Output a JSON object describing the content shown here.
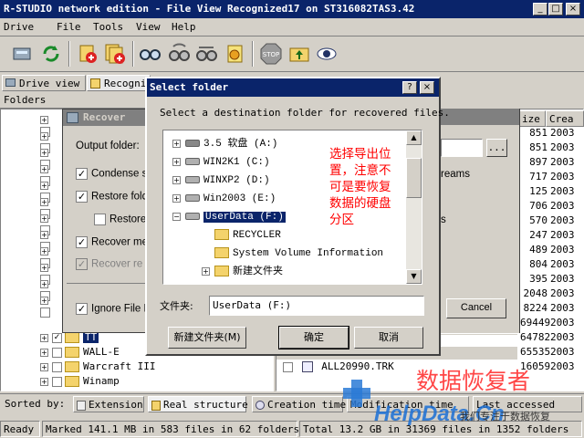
{
  "window": {
    "title": "R-STUDIO network edition - File View Recognized17 on ST316082TAS3.42"
  },
  "menu": [
    "Drive",
    "File",
    "Tools",
    "View",
    "Help"
  ],
  "toolbar": {
    "icons": [
      "drives-icon",
      "refresh-icon",
      "add-icon",
      "add-all-icon",
      "scan-icon",
      "scan-all-icon",
      "recover-icon",
      "open-icon",
      "stop-icon",
      "up-folder-icon",
      "view-icon"
    ],
    "stop_label": "STOP"
  },
  "tabs": {
    "drive_view": "Drive view",
    "recognized": "Recogni"
  },
  "folders_header": "Folders",
  "tree_items": [
    "TT",
    "WALL-E",
    "Warcraft III",
    "Winamp"
  ],
  "recover": {
    "title": "Recover",
    "output_folder": "Output folder:",
    "condense": "Condense s",
    "restore_folder": "Restore fold",
    "restore": "Restore",
    "recover_me": "Recover me",
    "recover_re": "Recover re",
    "ignore": "Ignore File M",
    "reams": "reams",
    "s_suffix": "s",
    "browse": "...",
    "cancel": "Cancel"
  },
  "list": {
    "columns": [
      "ize",
      "Crea"
    ],
    "sizes": [
      "851",
      "851",
      "897",
      "717",
      "125",
      "706",
      "570",
      "247",
      "489",
      "804",
      "395",
      "2048",
      "8224",
      "69449",
      "64782",
      "65535",
      "16059"
    ],
    "years": [
      "2003",
      "2003",
      "2003",
      "2003",
      "2003",
      "2003",
      "2003",
      "2003",
      "2003",
      "2003",
      "2003",
      "2003",
      "2003",
      "2003",
      "2003",
      "2003",
      "2003"
    ],
    "visible_file": "ALL20990.TRK"
  },
  "dialog": {
    "title": "Select folder",
    "help": "?",
    "close": "×",
    "instruction": "Select a destination folder for recovered files.",
    "tree": [
      {
        "label": "3.5 软盘 (A:)",
        "icon": "floppy-icon",
        "level": 0
      },
      {
        "label": "WIN2K1 (C:)",
        "icon": "drive-icon",
        "level": 0
      },
      {
        "label": "WINXP2 (D:)",
        "icon": "drive-icon",
        "level": 0
      },
      {
        "label": "Win2003 (E:)",
        "icon": "drive-icon",
        "level": 0
      },
      {
        "label": "UserData (F:)",
        "icon": "drive-icon",
        "level": 0,
        "selected": true
      },
      {
        "label": "RECYCLER",
        "icon": "folder-icon",
        "level": 1
      },
      {
        "label": "System Volume Information",
        "icon": "folder-icon",
        "level": 1
      },
      {
        "label": "新建文件夹",
        "icon": "folder-icon",
        "level": 1
      }
    ],
    "folder_label": "文件夹:",
    "folder_value": "UserData (F:)",
    "new_folder": "新建文件夹(M)",
    "ok": "确定",
    "cancel": "取消"
  },
  "annotation": [
    "选择导出位",
    "置，注意不",
    "可是要恢复",
    "数据的硬盘",
    "分区"
  ],
  "sortbar": {
    "label": "Sorted by:",
    "tabs": [
      "Extension",
      "Real structure",
      "Creation time",
      "Modification time",
      "Last accessed"
    ]
  },
  "status": {
    "ready": "Ready",
    "marked": "Marked 141.1 MB in 583 files in 62 folders",
    "total": "Total 13.2 GB in 31369 files in 1352 folders"
  },
  "watermark": {
    "cn": "数据恢复者",
    "url": "HelpData.Cn",
    "slogan": "我们专注于数据恢复"
  },
  "colors": {
    "titlebar": "#0a246a",
    "selection": "#0a246a",
    "annotation": "#ff0000",
    "face": "#d4d0c8"
  }
}
